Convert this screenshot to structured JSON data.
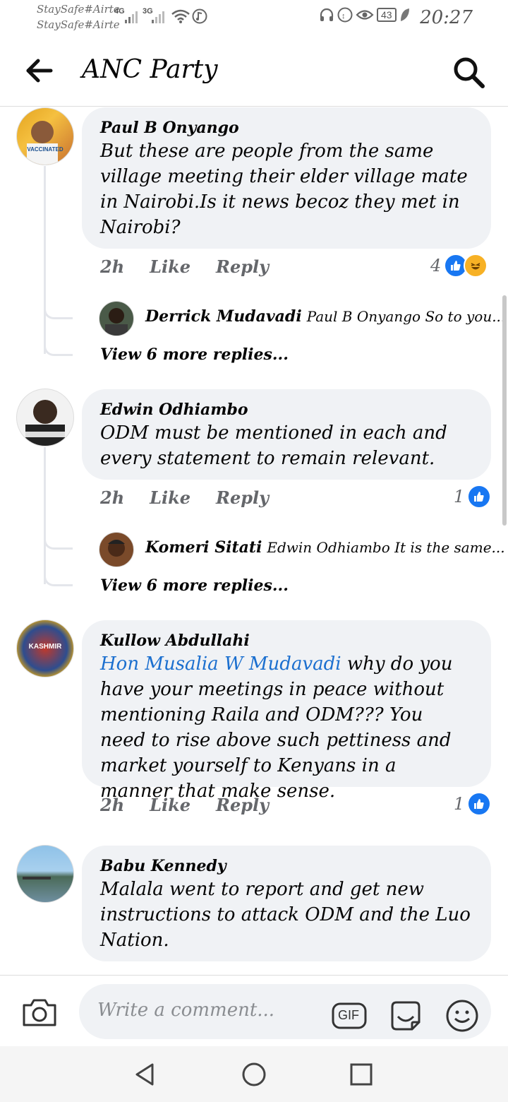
{
  "status": {
    "carrier1": "StaySafe#Airte",
    "carrier2": "StaySafe#Airte",
    "sig1": "4G",
    "sig2": "3G",
    "battery": "43",
    "time": "20:27"
  },
  "header": {
    "title": "ANC Party"
  },
  "labels": {
    "like": "Like",
    "reply": "Reply"
  },
  "comments": [
    {
      "author": "Paul B Onyango",
      "text": "But these are people from the same village meeting their elder village mate in Nairobi.Is it news becoz they met in Nairobi?",
      "time": "2h",
      "reactions": "4",
      "reply_author": "Derrick Mudavadi",
      "reply_text": "Paul B Onyango So to you...",
      "view_more": "View 6 more replies..."
    },
    {
      "author": "Edwin Odhiambo",
      "text": "ODM must be mentioned in each and every statement to remain relevant.",
      "time": "2h",
      "reactions": "1",
      "reply_author": "Komeri Sitati",
      "reply_text": "Edwin Odhiambo It is the same...",
      "view_more": "View 6 more replies..."
    },
    {
      "author": "Kullow Abdullahi",
      "mention": "Hon Musalia W Mudavadi",
      "text": " why do you have your meetings in peace without mentioning Raila and ODM??? You need to rise above such pettiness and market yourself to Kenyans in a manner that make sense.",
      "time": "2h",
      "reactions": "1"
    },
    {
      "author": "Babu Kennedy",
      "text": "Malala went to report and get new instructions to attack ODM and the Luo Nation."
    }
  ],
  "avatars": {
    "paul_badge": "VACCINATED",
    "kullow_badge": "KASHMIR"
  },
  "composer": {
    "placeholder": "Write a comment...",
    "gif": "GIF"
  },
  "colors": {
    "mention": "#1b6fcf",
    "like_blue": "#1877f2",
    "bubble": "#f0f2f5"
  }
}
